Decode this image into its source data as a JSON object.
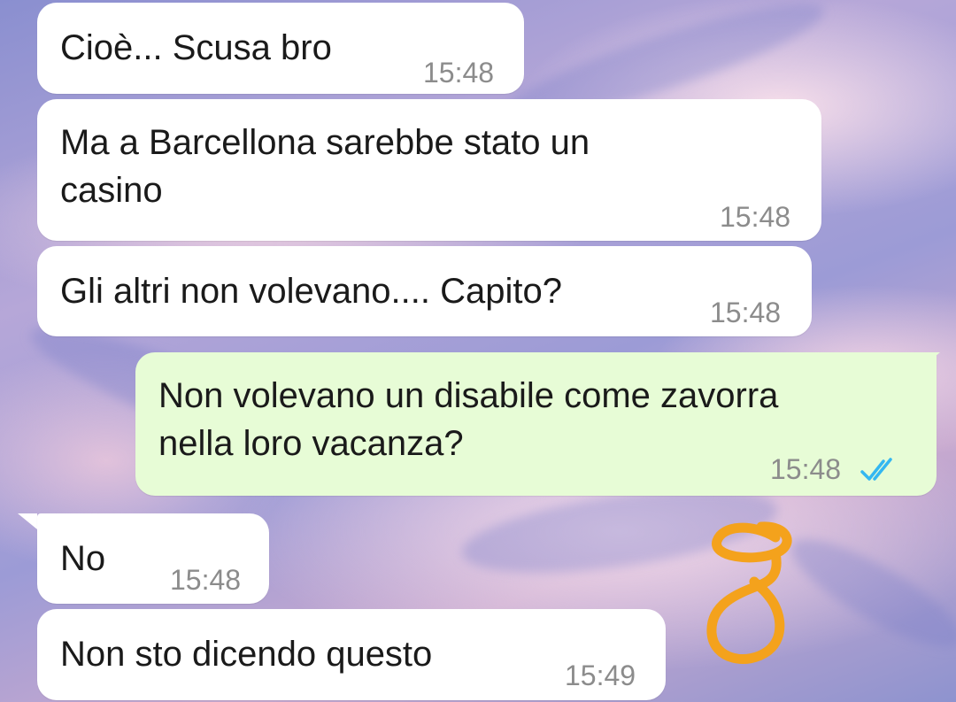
{
  "messages": [
    {
      "text": "Cioè... Scusa bro",
      "time": "15:48"
    },
    {
      "text": "Ma a Barcellona sarebbe stato un\ncasino",
      "time": "15:48"
    },
    {
      "text": "Gli altri non volevano.... Capito?",
      "time": "15:48"
    },
    {
      "text": "Non volevano un disabile come zavorra\nnella loro vacanza?",
      "time": "15:48",
      "status_icon": "double-check-read-icon"
    },
    {
      "text": "No",
      "time": "15:48"
    },
    {
      "text": "Non sto dicendo questo",
      "time": "15:49"
    }
  ],
  "colors": {
    "incoming_bubble": "#ffffff",
    "outgoing_bubble": "#e7fcd6",
    "read_ticks": "#34b7f1",
    "doodle": "#f4a21c"
  },
  "doodle": {
    "icon": "hand-drawn-8-doodle"
  }
}
